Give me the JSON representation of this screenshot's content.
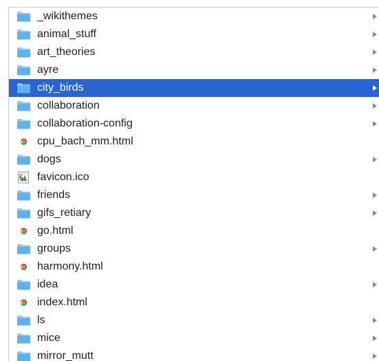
{
  "file_list": {
    "items": [
      {
        "name": "_wikithemes",
        "kind": "folder",
        "selected": false
      },
      {
        "name": "animal_stuff",
        "kind": "folder",
        "selected": false
      },
      {
        "name": "art_theories",
        "kind": "folder",
        "selected": false
      },
      {
        "name": "ayre",
        "kind": "folder",
        "selected": false
      },
      {
        "name": "city_birds",
        "kind": "folder",
        "selected": true
      },
      {
        "name": "collaboration",
        "kind": "folder",
        "selected": false
      },
      {
        "name": "collaboration-config",
        "kind": "folder",
        "selected": false
      },
      {
        "name": "cpu_bach_mm.html",
        "kind": "html",
        "selected": false
      },
      {
        "name": "dogs",
        "kind": "folder",
        "selected": false
      },
      {
        "name": "favicon.ico",
        "kind": "ico",
        "selected": false
      },
      {
        "name": "friends",
        "kind": "folder",
        "selected": false
      },
      {
        "name": "gifs_retiary",
        "kind": "folder",
        "selected": false
      },
      {
        "name": "go.html",
        "kind": "html",
        "selected": false
      },
      {
        "name": "groups",
        "kind": "folder",
        "selected": false
      },
      {
        "name": "harmony.html",
        "kind": "html",
        "selected": false
      },
      {
        "name": "idea",
        "kind": "folder",
        "selected": false
      },
      {
        "name": "index.html",
        "kind": "html",
        "selected": false
      },
      {
        "name": "ls",
        "kind": "folder",
        "selected": false
      },
      {
        "name": "mice",
        "kind": "folder",
        "selected": false
      },
      {
        "name": "mirror_mutt",
        "kind": "folder",
        "selected": false
      }
    ]
  },
  "icons": {
    "folder": "folder-icon",
    "html": "chrome-html-file-icon",
    "ico": "image-file-icon",
    "disclosure": "disclosure-arrow-icon"
  },
  "colors": {
    "selection": "#2a64d1",
    "folder_body": "#5fb3ec",
    "folder_tab": "#8ccbf3",
    "disclosure_arrow": "#8a8a8a",
    "text": "#1f1f1f"
  }
}
